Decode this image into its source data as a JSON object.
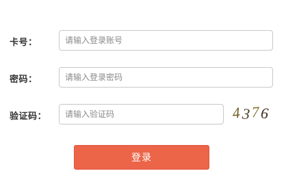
{
  "form": {
    "card": {
      "label": "卡号：",
      "placeholder": "请输入登录账号",
      "value": ""
    },
    "password": {
      "label": "密码：",
      "placeholder": "请输入登录密码",
      "value": ""
    },
    "captcha": {
      "label": "验证码：",
      "placeholder": "请输入验证码",
      "value": "",
      "image_text": "4376",
      "image_colors": [
        "#6b5a1e",
        "#4a3f22",
        "#8a7430",
        "#3d2c1c"
      ]
    },
    "submit_label": "登录"
  },
  "colors": {
    "accent": "#ec6549",
    "border": "#c8c8c8",
    "label": "#333333"
  }
}
